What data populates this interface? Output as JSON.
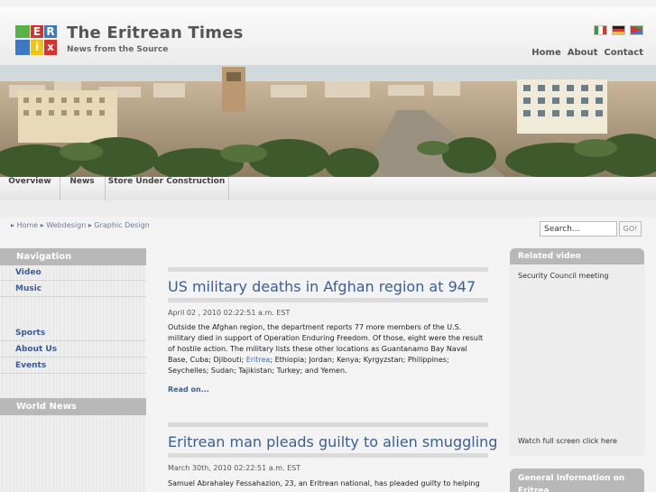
{
  "header": {
    "title": "The Eritrean Times",
    "subtitle": "News from the Source",
    "logo_letters": [
      "E",
      "R",
      "i",
      "x"
    ],
    "flags": [
      "italy-flag-icon",
      "germany-flag-icon",
      "eritrea-flag-icon"
    ],
    "nav": [
      "Home",
      "About",
      "Contact"
    ]
  },
  "tabs": [
    "Overview",
    "News",
    "Store Under Construction"
  ],
  "breadcrumb": [
    "Home",
    "Webdesign",
    "Graphic Design"
  ],
  "search": {
    "value": "Search...",
    "button": "GO!"
  },
  "leftnav": {
    "heading": "Navigation",
    "group1": [
      "Video",
      "Music"
    ],
    "group2": [
      "Sports",
      "About Us",
      "Events"
    ],
    "heading2": "World News"
  },
  "articles": [
    {
      "title": "US military deaths in Afghan region at 947",
      "date": "April 02 , 2010 02:22:51 a.m. EST",
      "body_before": "Outside the Afghan region, the department reports 77 more members of the U.S. military died in support of Operation Enduring Freedom. Of those, eight were the result of hostile action. The military lists these other locations as Guantanamo Bay Naval Base, Cuba; Djibouti; ",
      "body_link": "Eritrea",
      "body_after": "; Ethiopia; Jordan; Kenya; Kyrgyzstan; Philippines; Seychelles; Sudan; Tajikistan; Turkey; and Yemen.",
      "read_on": "Read on..."
    },
    {
      "title": "Eritrean man pleads guilty to alien smuggling",
      "date": "March 30th, 2010 02:22:51 a.m. EST",
      "body": "Samuel Abrahaley Fessahazion, 23, an Eritrean national, has pleaded guilty to helping"
    }
  ],
  "right": {
    "video_heading": "Related video",
    "video_item": "Security Council meeting",
    "video_footer": "Watch full screen click here",
    "info_heading": "General Information on Eritrea"
  },
  "colors": {
    "link_blue": "#3a5f96",
    "header_gray": "#b8b8b8",
    "logo_green": "#55b34a",
    "logo_red": "#d6322e",
    "logo_blue": "#3d78c4",
    "logo_yellow": "#f0c419"
  }
}
